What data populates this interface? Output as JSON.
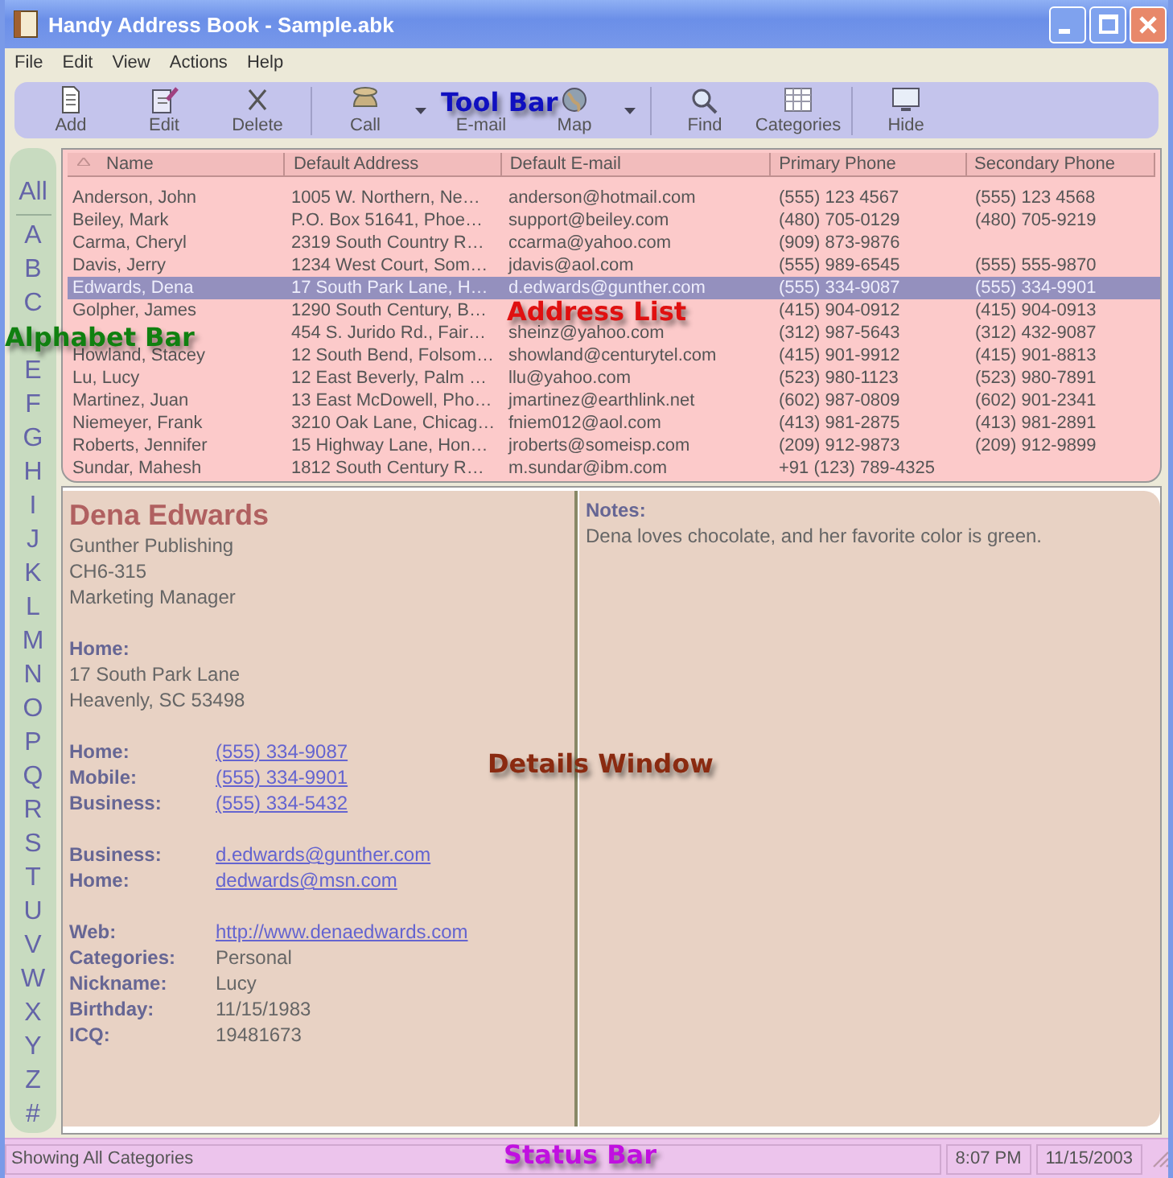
{
  "window": {
    "title": "Handy Address Book - Sample.abk"
  },
  "menu": [
    "File",
    "Edit",
    "View",
    "Actions",
    "Help"
  ],
  "toolbar": {
    "items": [
      {
        "kind": "button",
        "label": "Add"
      },
      {
        "kind": "button",
        "label": "Edit"
      },
      {
        "kind": "button",
        "label": "Delete"
      },
      {
        "kind": "separator"
      },
      {
        "kind": "button",
        "label": "Call"
      },
      {
        "kind": "dropdown"
      },
      {
        "kind": "button",
        "label": "E-mail"
      },
      {
        "kind": "button",
        "label": "Map"
      },
      {
        "kind": "dropdown"
      },
      {
        "kind": "separator"
      },
      {
        "kind": "button",
        "label": "Find"
      },
      {
        "kind": "button",
        "label": "Categories"
      },
      {
        "kind": "separator"
      },
      {
        "kind": "button",
        "label": "Hide"
      }
    ]
  },
  "alphabet_bar": {
    "items": [
      "All",
      "A",
      "B",
      "C",
      "E",
      "F",
      "G",
      "H",
      "I",
      "J",
      "K",
      "L",
      "M",
      "N",
      "O",
      "P",
      "Q",
      "R",
      "S",
      "T",
      "U",
      "V",
      "W",
      "X",
      "Y",
      "Z",
      "#"
    ]
  },
  "address_list": {
    "columns": [
      "Name",
      "Default Address",
      "Default E-mail",
      "Primary Phone",
      "Secondary Phone"
    ],
    "rows": [
      {
        "cells": [
          "Anderson, John",
          "1005 W. Northern, Ne…",
          "anderson@hotmail.com",
          "(555) 123 4567",
          "(555) 123 4568"
        ],
        "selected": false
      },
      {
        "cells": [
          "Beiley, Mark",
          "P.O. Box 51641, Phoe…",
          "support@beiley.com",
          "(480) 705-0129",
          "(480) 705-9219"
        ],
        "selected": false
      },
      {
        "cells": [
          "Carma, Cheryl",
          "2319 South Country R…",
          "ccarma@yahoo.com",
          "(909) 873-9876",
          null
        ],
        "selected": false
      },
      {
        "cells": [
          "Davis, Jerry",
          "1234 West Court, Som…",
          "jdavis@aol.com",
          "(555) 989-6545",
          "(555) 555-9870"
        ],
        "selected": false
      },
      {
        "cells": [
          "Edwards, Dena",
          "17 South Park Lane, H…",
          "d.edwards@gunther.com",
          "(555) 334-9087",
          "(555) 334-9901"
        ],
        "selected": true
      },
      {
        "cells": [
          "Golpher, James",
          "1290 South Century, B…",
          null,
          "(415) 904-0912",
          "(415) 904-0913"
        ],
        "selected": false
      },
      {
        "cells": [
          null,
          "454 S. Jurido Rd., Fair…",
          "sheinz@yahoo.com",
          "(312) 987-5643",
          "(312) 432-9087"
        ],
        "selected": false
      },
      {
        "cells": [
          "Howland, Stacey",
          "12 South Bend, Folsom…",
          "showland@centurytel.com",
          "(415) 901-9912",
          "(415) 901-8813"
        ],
        "selected": false
      },
      {
        "cells": [
          "Lu, Lucy",
          "12 East Beverly, Palm …",
          "llu@yahoo.com",
          "(523) 980-1123",
          "(523) 980-7891"
        ],
        "selected": false
      },
      {
        "cells": [
          "Martinez, Juan",
          "13 East McDowell, Pho…",
          "jmartinez@earthlink.net",
          "(602) 987-0809",
          "(602) 901-2341"
        ],
        "selected": false
      },
      {
        "cells": [
          "Niemeyer, Frank",
          "3210 Oak Lane, Chicag…",
          "fniem012@aol.com",
          "(413) 981-2875",
          "(413) 981-2891"
        ],
        "selected": false
      },
      {
        "cells": [
          "Roberts, Jennifer",
          "15 Highway Lane, Hon…",
          "jroberts@someisp.com",
          "(209) 912-9873",
          "(209) 912-9899"
        ],
        "selected": false
      },
      {
        "cells": [
          "Sundar, Mahesh",
          "1812 South Century R…",
          "m.sundar@ibm.com",
          "+91 (123) 789-4325",
          null
        ],
        "selected": false
      }
    ]
  },
  "details": {
    "name": "Dena Edwards",
    "lines": [
      "Gunther Publishing",
      "CH6-315",
      "Marketing Manager"
    ],
    "blocks": [
      {
        "kind": "address",
        "label": "Home:",
        "lines": [
          "17 South Park Lane",
          "Heavenly, SC  53498"
        ]
      },
      {
        "kind": "fields",
        "fields": [
          {
            "label": "Home:",
            "value": "(555) 334-9087",
            "link": true
          },
          {
            "label": "Mobile:",
            "value": "(555) 334-9901",
            "link": true
          },
          {
            "label": "Business:",
            "value": "(555) 334-5432",
            "link": true
          }
        ]
      },
      {
        "kind": "fields",
        "fields": [
          {
            "label": "Business:",
            "value": "d.edwards@gunther.com",
            "link": true
          },
          {
            "label": "Home:",
            "value": "dedwards@msn.com",
            "link": true
          }
        ]
      },
      {
        "kind": "fields",
        "fields": [
          {
            "label": "Web:",
            "value": "http://www.denaedwards.com",
            "link": true
          },
          {
            "label": "Categories:",
            "value": "Personal",
            "link": false
          },
          {
            "label": "Nickname:",
            "value": "Lucy",
            "link": false
          },
          {
            "label": "Birthday:",
            "value": "11/15/1983",
            "link": false
          },
          {
            "label": "ICQ:",
            "value": "19481673",
            "link": false
          }
        ]
      }
    ],
    "notes": {
      "label": "Notes:",
      "text": "Dena loves chocolate, and her favorite color is green."
    }
  },
  "status_bar": {
    "text": "Showing All Categories",
    "time": "8:07 PM",
    "date": "11/15/2003"
  },
  "callouts": [
    {
      "text": "Tool Bar",
      "color": "#1010c0"
    },
    {
      "text": "Address List",
      "color": "#e01010"
    },
    {
      "text": "Alphabet Bar",
      "color": "#108010"
    },
    {
      "text": "Details Window",
      "color": "#8a2a10"
    },
    {
      "text": "Status Bar",
      "color": "#c010e0"
    }
  ]
}
